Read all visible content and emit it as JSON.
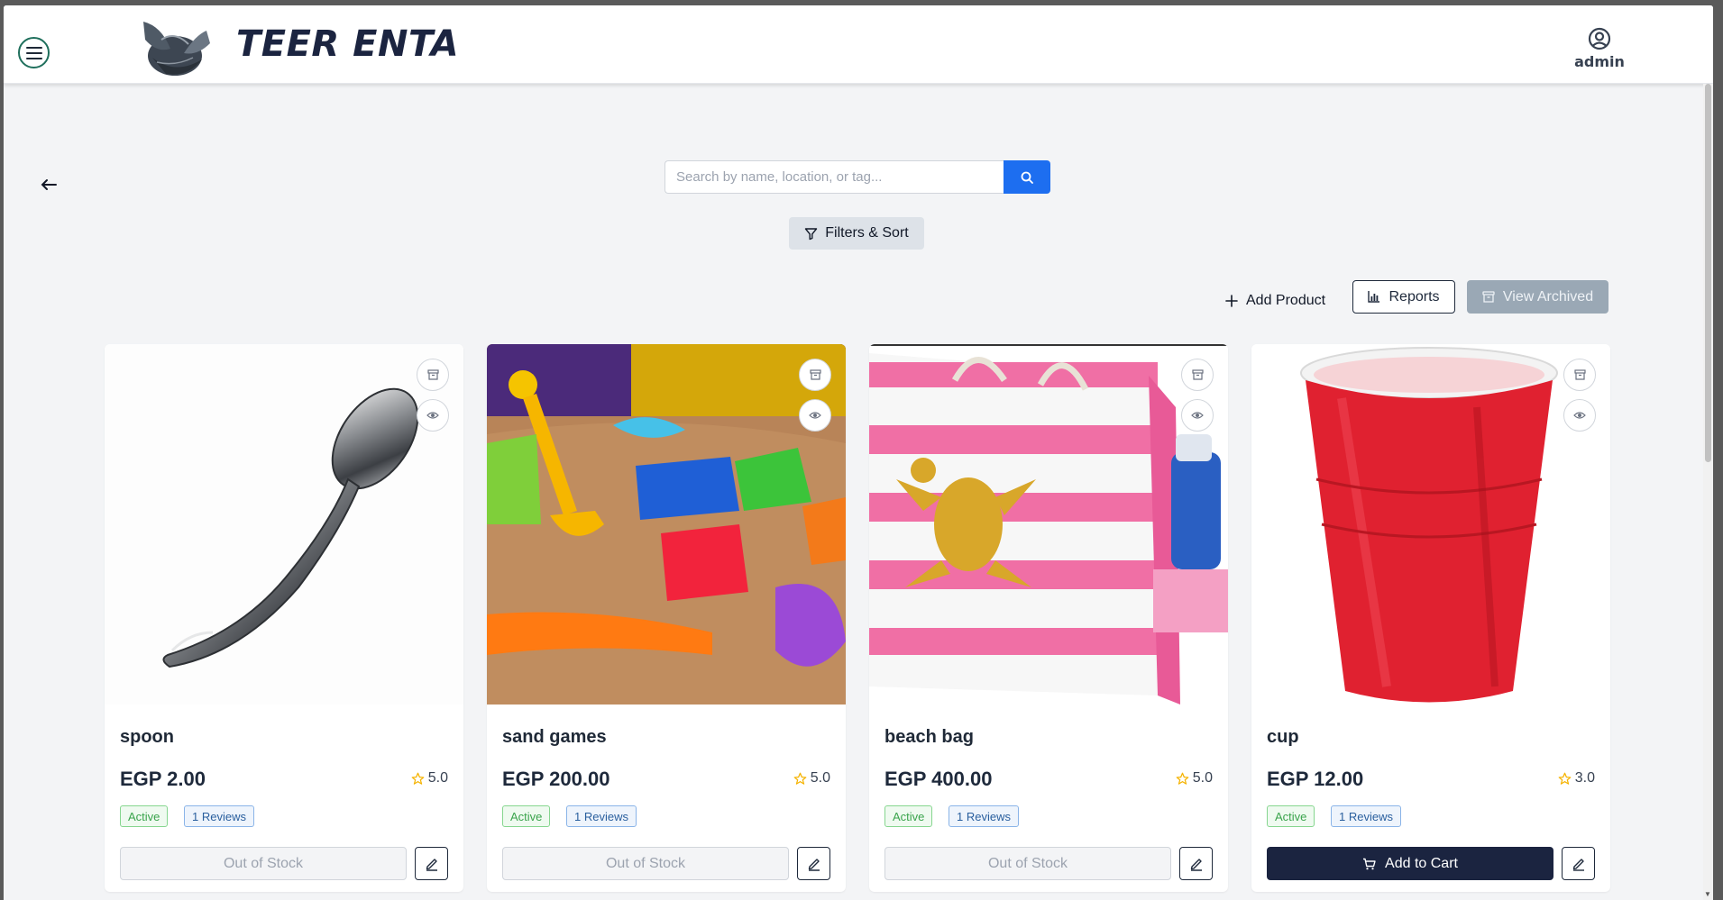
{
  "app": {
    "brand": "TEER ENTA",
    "user": "admin"
  },
  "search": {
    "placeholder": "Search by name, location, or tag...",
    "value": ""
  },
  "toolbar": {
    "filters_label": "Filters & Sort",
    "add_product_label": "Add Product",
    "reports_label": "Reports",
    "archived_label": "View Archived"
  },
  "products": [
    {
      "name": "spoon",
      "price": "EGP 2.00",
      "rating": "5.0",
      "status": "Active",
      "reviews": "1 Reviews",
      "action": "Out of Stock"
    },
    {
      "name": "sand games",
      "price": "EGP 200.00",
      "rating": "5.0",
      "status": "Active",
      "reviews": "1 Reviews",
      "action": "Out of Stock"
    },
    {
      "name": "beach bag",
      "price": "EGP 400.00",
      "rating": "5.0",
      "status": "Active",
      "reviews": "1 Reviews",
      "action": "Out of Stock"
    },
    {
      "name": "cup",
      "price": "EGP 12.00",
      "rating": "3.0",
      "status": "Active",
      "reviews": "1 Reviews",
      "action": "Add to Cart"
    }
  ],
  "colors": {
    "primary": "#1b2440",
    "search_button": "#1d6ef0",
    "active_badge": "#3aa44c",
    "reviews_badge": "#2a5f9e",
    "star": "#f5b301"
  }
}
